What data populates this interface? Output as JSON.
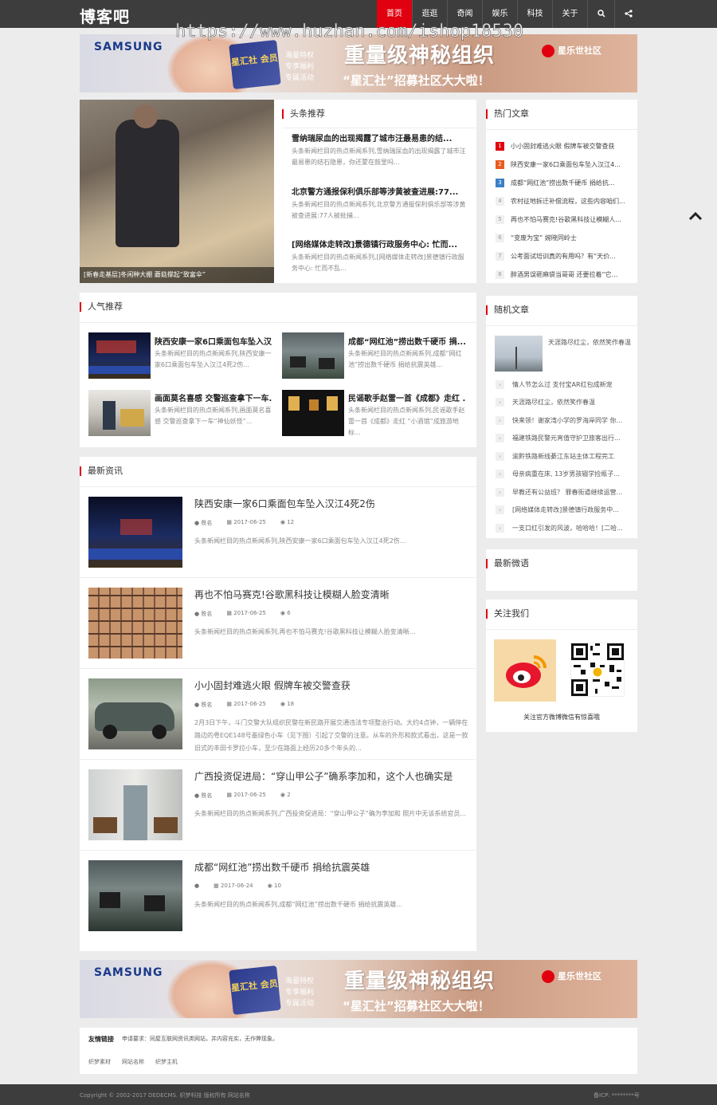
{
  "header": {
    "logo": "博客吧",
    "nav": [
      "首页",
      "逛逛",
      "奇闻",
      "娱乐",
      "科技",
      "关于"
    ],
    "search_icon": "search-icon",
    "share_icon": "share-icon"
  },
  "watermark": "https://www.huzhan.com/ishop18530",
  "banner": {
    "brand": "SAMSUNG",
    "card": "星汇社 会员",
    "side": "海量特权\n专享福利\n专属活动",
    "headline": "重量级神秘组织",
    "sub": "“星汇社”招募社区大大啦！",
    "community": "星乐世社区"
  },
  "headline_section": {
    "title": "头条推荐",
    "feature_caption": "[新春走基层]冬闲种大棚 蘑菇撑起“致富伞”",
    "items": [
      {
        "title": "雪纳瑞尿血的出现揭露了城市汪最易患的结...",
        "desc": "头条新闻栏目的热点新闻系列,雪纳瑞尿血的出现揭露了城市汪最易患的结石隐患，你还蒙在鼓里吗..."
      },
      {
        "title": "北京警方通报保利俱乐部等涉黄被查进展:77...",
        "desc": "头条新闻栏目的热点新闻系列,北京警方通报保利俱乐部等涉黄被查进展:77人被批捕..."
      },
      {
        "title": "[网络媒体走转改]景德镇行政服务中心: 忙而...",
        "desc": "头条新闻栏目的热点新闻系列,[网络媒体走转改]景德镇行政服务中心: 忙而不乱..."
      }
    ]
  },
  "hot": {
    "title": "热门文章",
    "items": [
      {
        "n": "1",
        "t": "小小固封难逃火眼 假牌车被交警查获"
      },
      {
        "n": "2",
        "t": "陕西安康一家6口乘面包车坠入汉江4..."
      },
      {
        "n": "3",
        "t": "成都“网红池”捞出数千硬币 捐给抗..."
      },
      {
        "n": "4",
        "t": "农村征地拆迁补偿流程，这些内容咱们..."
      },
      {
        "n": "5",
        "t": "再也不怕马赛克!谷歌黑科技让模糊人..."
      },
      {
        "n": "6",
        "t": "“变废为宝” 婉晓同岭士"
      },
      {
        "n": "7",
        "t": "公考面试培训真的有用吗？有“天价..."
      },
      {
        "n": "8",
        "t": "醉酒男误砸麻袋当哥哥 还要拉着“它..."
      }
    ]
  },
  "popular": {
    "title": "人气推荐",
    "items": [
      {
        "title": "陕西安康一家6口乘面包车坠入汉...",
        "desc": "头条新闻栏目的热点新闻系列,陕西安康一家6口乘面包车坠入汉江4死2伤..."
      },
      {
        "title": "成都“网红池”捞出数千硬币 捐...",
        "desc": "头条新闻栏目的热点新闻系列,成都“网红池”捞出数千硬币 捐给抗震英雄..."
      },
      {
        "title": "画面莫名喜感 交警巡查拿下一车...",
        "desc": "头条新闻栏目的热点新闻系列,画面莫名喜感 交警巡查拿下一车“神仙妖怪”..."
      },
      {
        "title": "民谣歌手赵雷一首《成都》走红 ...",
        "desc": "头条新闻栏目的热点新闻系列,民谣歌手赵雷一首《成都》走红 “小酒馆”成旅游地标..."
      }
    ]
  },
  "random": {
    "title": "随机文章",
    "feature": "天涯路尽红尘，依然笑作春温",
    "items": [
      "情人节怎么过 支付宝AR红包成新宠",
      "天涯路尽红尘，依然笑作春温",
      "快来领！谢家湾小学的罗海岸同学 你...",
      "福建铁路民警元宵值守护卫旅客出行...",
      "渝黔铁路新线綦江东站主体工程完工",
      "母亲病重在床, 13岁男孩辍学捡瓶子...",
      "早教还有公益班？ 罪春街道继续运营...",
      "[网络媒体走转改]景德镇行政服务中...",
      "一支口红引发的风波，哈哈哈！[二哈..."
    ]
  },
  "weibo": {
    "title": "最新微语"
  },
  "follow": {
    "title": "关注我们",
    "caption": "关注官方微博微信有惊喜哦"
  },
  "latest": {
    "title": "最新资讯",
    "items": [
      {
        "title": "陕西安康一家6口乘面包车坠入汉江4死2伤",
        "author": "秩名",
        "date": "2017-06-25",
        "views": "12",
        "desc": "头条新闻栏目的热点新闻系列,陕西安康一家6口乘面包车坠入汉江4死2伤..."
      },
      {
        "title": "再也不怕马赛克!谷歌黑科技让模糊人脸变清晰",
        "author": "秩名",
        "date": "2017-06-25",
        "views": "6",
        "desc": "头条新闻栏目的热点新闻系列,再也不怕马赛克!谷歌黑科技让模糊人脸变清晰..."
      },
      {
        "title": "小小固封难逃火眼 假牌车被交警查获",
        "author": "秩名",
        "date": "2017-06-25",
        "views": "18",
        "desc": "2月3日下午，斗门交警大队组织民警在新民路开展交通违法专项整治行动。大约4点钟，一辆停在路边的粤EQE148号墨绿色小车（见下图）引起了交警的注意。从车的外形和款式看出，这是一款旧式的丰田卡罗拉小车，至少在路面上经历20多个年头的..."
      },
      {
        "title": "广西投资促进局：“穿山甲公子”确系李加和，这个人也确实是",
        "author": "秩名",
        "date": "2017-06-25",
        "views": "2",
        "desc": "头条新闻栏目的热点新闻系列,广西投资促进局：“穿山甲公子”确为李加和 照片中无该系统官员..."
      },
      {
        "title": "成都“网红池”捞出数千硬币 捐给抗震英雄",
        "author": "",
        "date": "2017-06-24",
        "views": "10",
        "desc": "头条新闻栏目的热点新闻系列,成都“网红池”捞出数千硬币 捐给抗震英雄..."
      }
    ]
  },
  "links": {
    "title": "友情链接",
    "apply": "申请要求：同屋互联网资讯类网站，并内容充实，无作弊现象。",
    "items": [
      "织梦素材",
      "网站名称",
      "织梦主机"
    ]
  },
  "footer": {
    "copyright": "Copyright © 2002-2017 DEDECMS. 织梦科技 版权所有 网站名称",
    "icp": "备ICP: ********号"
  },
  "colors": {
    "accent": "#e0000f",
    "topbar": "#3d3d3d",
    "bg": "#ececec"
  }
}
